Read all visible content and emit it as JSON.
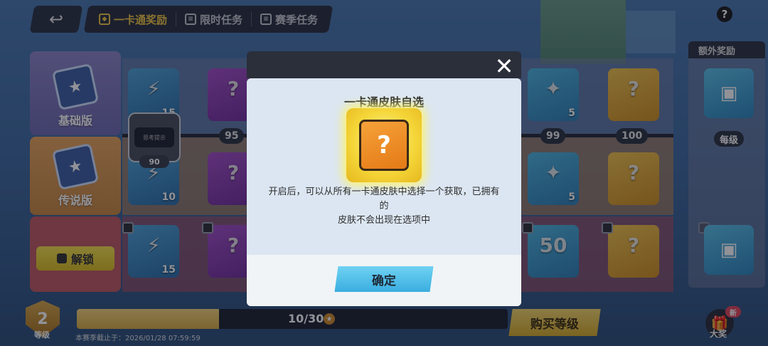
{
  "topbar": {
    "back_icon": "back-arrow-icon",
    "tabs": [
      {
        "label": "一卡通奖励",
        "active": true,
        "icon": "ticket-icon"
      },
      {
        "label": "限时任务",
        "active": false,
        "icon": "list-icon"
      },
      {
        "label": "赛季任务",
        "active": false,
        "icon": "list-icon"
      }
    ],
    "help_label": "?"
  },
  "tiers": {
    "basic": {
      "label": "基础版"
    },
    "legend": {
      "label": "传说版"
    },
    "locked": {
      "unlock_label": "解锁"
    }
  },
  "levels": [
    "95",
    "99",
    "100"
  ],
  "rewards": {
    "row1_counts": [
      "15",
      "5"
    ],
    "row2_counts": [
      "10",
      "5"
    ],
    "row3_counts": [
      "15",
      "50"
    ]
  },
  "avatar_frame": {
    "level": "90",
    "inner_text": "思考提示"
  },
  "extra": {
    "title": "额外奖励",
    "tag": "每级"
  },
  "bottom": {
    "rank_level": "2",
    "rank_label": "等级",
    "xp_text": "10/30",
    "xp_progress": 0.33,
    "season_end": "本赛季截止于：2026/01/28 07:59:59",
    "buy_label": "购买等级",
    "grand_prize_label": "大奖",
    "new_badge": "新"
  },
  "modal": {
    "title": "一卡通皮肤自选",
    "item_icon": "mystery-box-icon",
    "description_line1": "开启后，可以从所有一卡通皮肤中选择一个获取，已拥有的",
    "description_line2": "皮肤不会出现在选项中",
    "confirm_label": "确定",
    "close_icon": "close-icon"
  },
  "colors": {
    "accent_gold": "#f2c744",
    "confirm_blue": "#3aaee0",
    "modal_bg": "#dce6f2"
  }
}
